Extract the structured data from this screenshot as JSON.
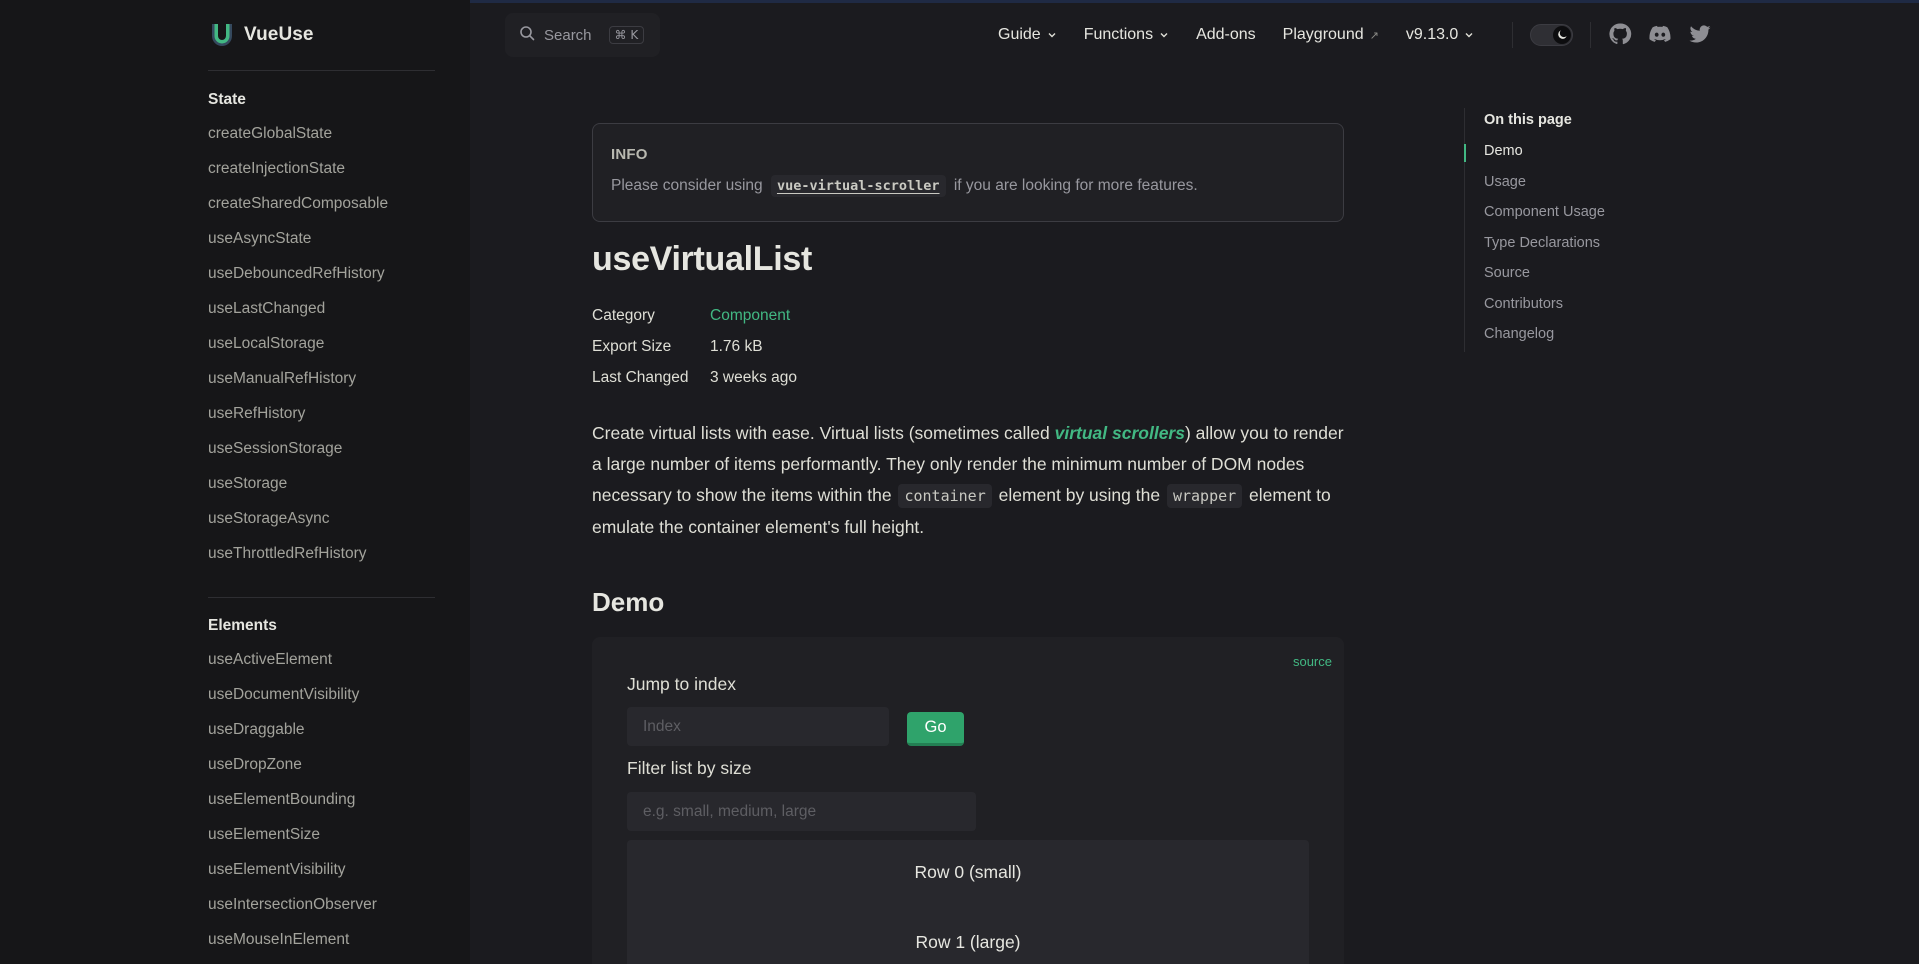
{
  "brand": {
    "name": "VueUse",
    "logo": "vueuse-logo",
    "accent": "#42b883"
  },
  "search": {
    "label": "Search",
    "shortcut": "⌘ K"
  },
  "nav": {
    "items": [
      {
        "label": "Guide",
        "icon": "chevron-down-icon"
      },
      {
        "label": "Functions",
        "icon": "chevron-down-icon"
      },
      {
        "label": "Add-ons"
      },
      {
        "label": "Playground",
        "icon": "external-link-icon"
      },
      {
        "label": "v9.13.0",
        "icon": "chevron-down-icon"
      }
    ],
    "theme_toggle": "dark-mode",
    "social": [
      "github-icon",
      "discord-icon",
      "twitter-icon"
    ]
  },
  "sidebar": {
    "sections": [
      {
        "title": "State",
        "items": [
          "createGlobalState",
          "createInjectionState",
          "createSharedComposable",
          "useAsyncState",
          "useDebouncedRefHistory",
          "useLastChanged",
          "useLocalStorage",
          "useManualRefHistory",
          "useRefHistory",
          "useSessionStorage",
          "useStorage",
          "useStorageAsync",
          "useThrottledRefHistory"
        ]
      },
      {
        "title": "Elements",
        "items": [
          "useActiveElement",
          "useDocumentVisibility",
          "useDraggable",
          "useDropZone",
          "useElementBounding",
          "useElementSize",
          "useElementVisibility",
          "useIntersectionObserver",
          "useMouseInElement"
        ]
      }
    ]
  },
  "info": {
    "title": "INFO",
    "text_before": "Please consider using",
    "code": "vue-virtual-scroller",
    "text_after": "if you are looking for more features."
  },
  "page": {
    "title": "useVirtualList",
    "meta": [
      {
        "key": "Category",
        "value": "Component"
      },
      {
        "key": "Export Size",
        "value": "1.76 kB"
      },
      {
        "key": "Last Changed",
        "value": "3 weeks ago"
      }
    ],
    "description": {
      "p1": "Create virtual lists with ease. Virtual lists (sometimes called ",
      "link": "virtual scrollers",
      "p2": ") allow you to render a large number of items performantly. They only render the minimum number of DOM nodes necessary to show the items within the ",
      "code1": "container",
      "p3": " element by using the ",
      "code2": "wrapper",
      "p4": " element to emulate the container element's full height."
    }
  },
  "demo": {
    "heading": "Demo",
    "source_label": "source",
    "jump_label": "Jump to index",
    "index_placeholder": "Index",
    "go_label": "Go",
    "filter_label": "Filter list by size",
    "filter_placeholder": "e.g. small, medium, large",
    "rows": [
      "Row 0 (small)",
      "Row 1 (large)"
    ]
  },
  "aside": {
    "title": "On this page",
    "items": [
      "Demo",
      "Usage",
      "Component Usage",
      "Type Declarations",
      "Source",
      "Contributors",
      "Changelog"
    ],
    "active": "Demo"
  }
}
